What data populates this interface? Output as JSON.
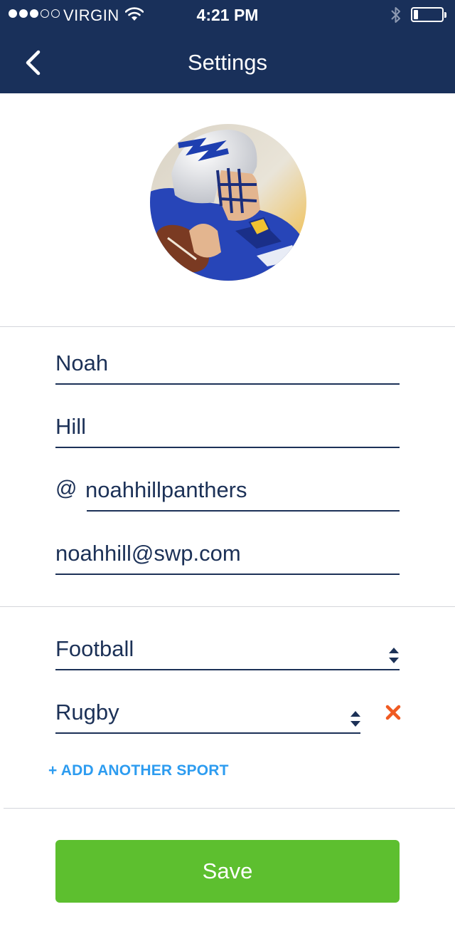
{
  "status_bar": {
    "carrier": "VIRGIN",
    "time": "4:21 PM",
    "signal_bars_filled": 3,
    "signal_bars_total": 5,
    "battery_level": 0.15
  },
  "nav": {
    "title": "Settings",
    "back_icon": "chevron-left-icon"
  },
  "profile": {
    "first_name": "Noah",
    "last_name": "Hill",
    "username_prefix": "@",
    "username": "noahhillpanthers",
    "email": "noahhill@swp.com"
  },
  "sports": {
    "items": [
      {
        "label": "Football",
        "removable": false
      },
      {
        "label": "Rugby",
        "removable": true
      }
    ],
    "add_label": "+ ADD ANOTHER SPORT"
  },
  "actions": {
    "save_label": "Save"
  },
  "colors": {
    "header_bg": "#19305a",
    "text": "#1c3157",
    "accent_link": "#2d9cf0",
    "save_bg": "#5dbf2f",
    "remove_icon": "#f05a22"
  }
}
